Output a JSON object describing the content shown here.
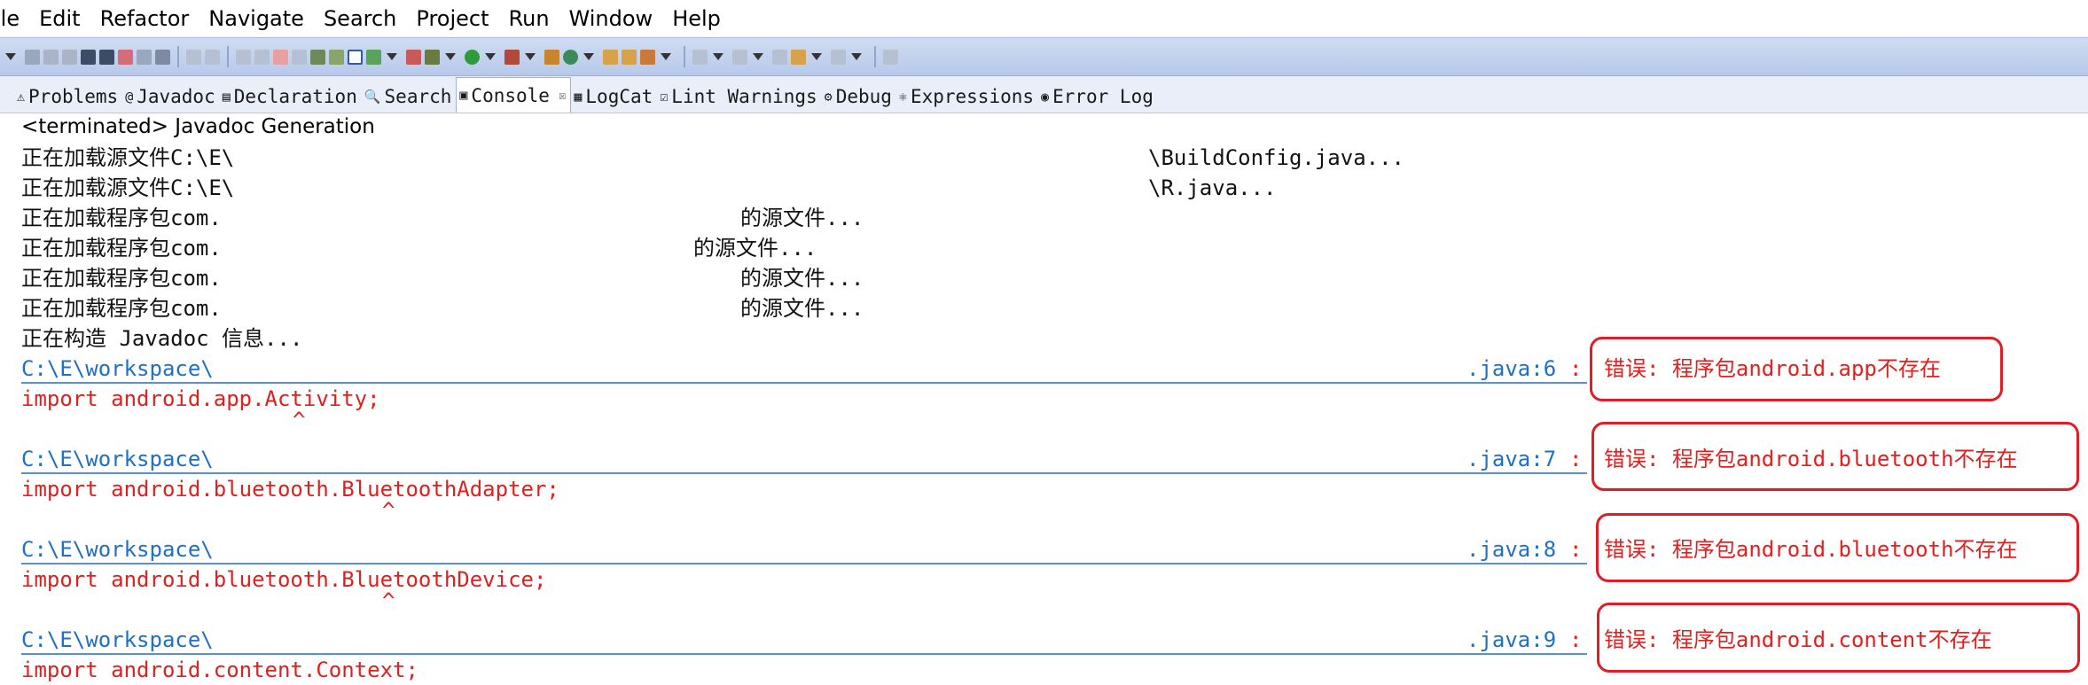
{
  "menu": [
    "ile",
    "Edit",
    "Refactor",
    "Navigate",
    "Search",
    "Project",
    "Run",
    "Window",
    "Help"
  ],
  "tabs": [
    {
      "label": "Problems",
      "icon": "problems-icon",
      "glyph": "⚠"
    },
    {
      "label": "Javadoc",
      "icon": "javadoc-icon",
      "glyph": "@"
    },
    {
      "label": "Declaration",
      "icon": "declaration-icon",
      "glyph": "▤"
    },
    {
      "label": "Search",
      "icon": "search-icon",
      "glyph": "🔍"
    },
    {
      "label": "Console",
      "icon": "console-icon",
      "glyph": "▣",
      "active": true,
      "close": "☒"
    },
    {
      "label": "LogCat",
      "icon": "logcat-icon",
      "glyph": "▦"
    },
    {
      "label": "Lint Warnings",
      "icon": "lint-icon",
      "glyph": "☑"
    },
    {
      "label": "Debug",
      "icon": "debug-icon",
      "glyph": "⚙"
    },
    {
      "label": "Expressions",
      "icon": "expressions-icon",
      "glyph": "⚛"
    },
    {
      "label": "Error Log",
      "icon": "error-log-icon",
      "glyph": "◉"
    }
  ],
  "console": {
    "status": "<terminated> Javadoc Generation",
    "loading": [
      {
        "left": "正在加载源文件C:\\E\\",
        "right": "\\BuildConfig.java..."
      },
      {
        "left": "正在加载源文件C:\\E\\",
        "right": "\\R.java..."
      },
      {
        "left": "正在加载程序包com.",
        "right": "的源文件..."
      },
      {
        "left": "正在加载程序包com.",
        "right": "的源文件..."
      },
      {
        "left": "正在加载程序包com.",
        "right": "的源文件..."
      },
      {
        "left": "正在加载程序包com.",
        "right": "的源文件..."
      }
    ],
    "building": "正在构造 Javadoc 信息...",
    "errors": [
      {
        "path": "C:\\E\\workspace\\",
        "loc": ".java:6",
        "colon": ":",
        "message": "错误: 程序包android.app不存在",
        "code": "import android.app.Activity;",
        "caret": "^"
      },
      {
        "path": "C:\\E\\workspace\\",
        "loc": ".java:7",
        "colon": ":",
        "message": "错误: 程序包android.bluetooth不存在",
        "code": "import android.bluetooth.BluetoothAdapter;",
        "caret": "^"
      },
      {
        "path": "C:\\E\\workspace\\",
        "loc": ".java:8",
        "colon": ":",
        "message": "错误: 程序包android.bluetooth不存在",
        "code": "import android.bluetooth.BluetoothDevice;",
        "caret": "^"
      },
      {
        "path": "C:\\E\\workspace\\",
        "loc": ".java:9",
        "colon": ":",
        "message": "错误: 程序包android.content不存在",
        "code": "import android.content.Context;"
      }
    ]
  },
  "colors": {
    "error": "#e0201f",
    "link": "#1f6fc5",
    "callout": "#e01c24",
    "toolbar": "#c3d3ee"
  }
}
